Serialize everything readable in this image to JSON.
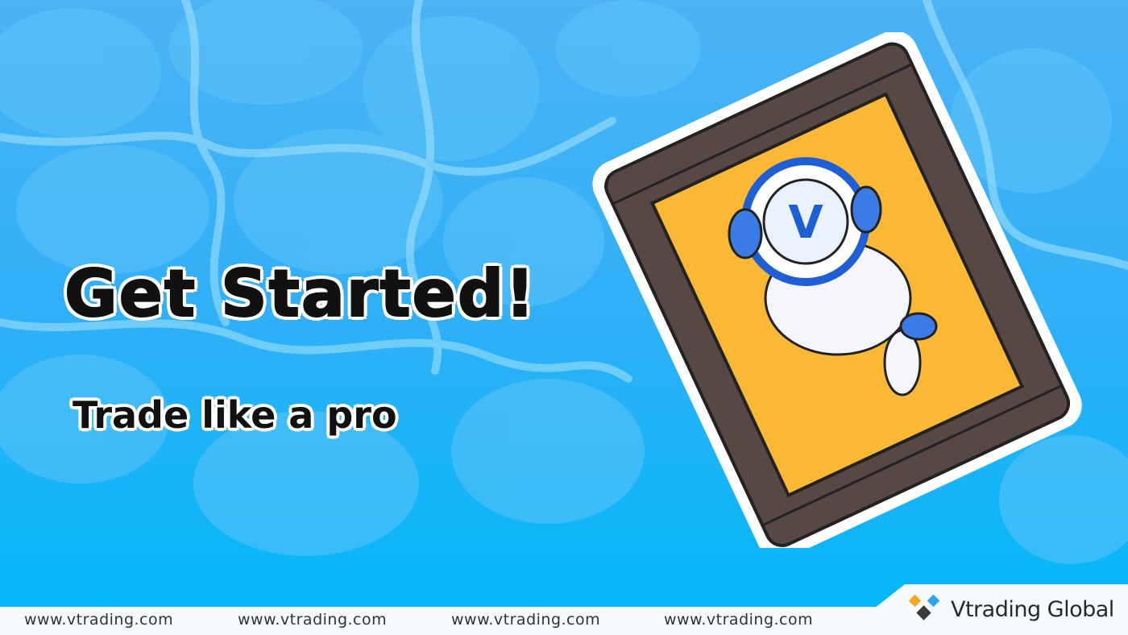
{
  "headline": "Get Started!",
  "subheadline": "Trade like a pro",
  "footer": {
    "urls": [
      "www.vtrading.com",
      "www.vtrading.com",
      "www.vtrading.com",
      "www.vtrading.com"
    ]
  },
  "brand": {
    "name": "Vtrading Global",
    "colors": {
      "orange": "#f5a623",
      "blue": "#2aa5f0",
      "dark": "#3b3a3d"
    }
  },
  "illustration": {
    "badge_letter": "V"
  }
}
